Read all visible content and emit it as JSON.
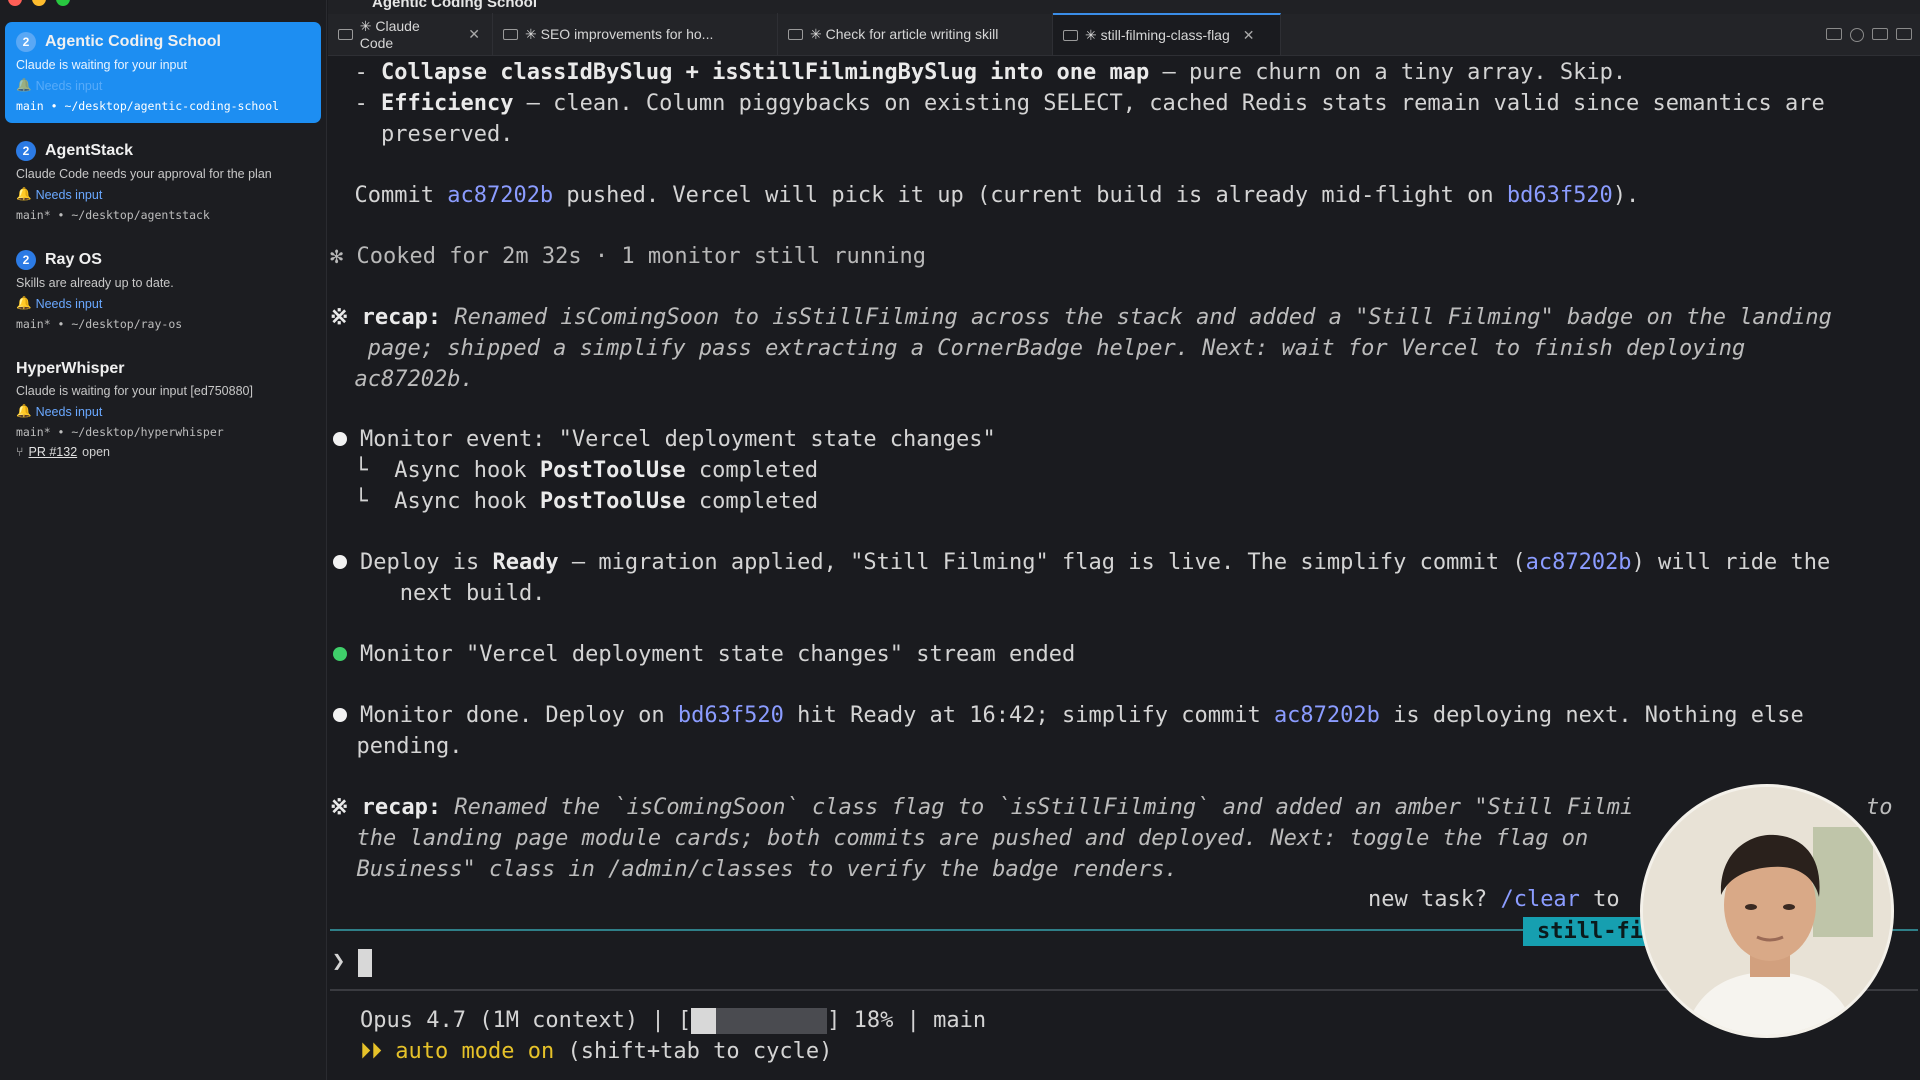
{
  "window": {
    "title": "Agentic Coding School"
  },
  "sessions": [
    {
      "num": "2",
      "title": "Agentic Coding School",
      "desc": "Claude is waiting for your input",
      "needs": "Needs input",
      "branch": "main • ~/desktop/agentic-coding-school"
    },
    {
      "num": "2",
      "title": "AgentStack",
      "desc": "Claude Code needs your approval for the plan",
      "needs": "Needs input",
      "branch": "main* • ~/desktop/agentstack"
    },
    {
      "num": "2",
      "title": "Ray OS",
      "desc": "Skills are already up to date.",
      "needs": "Needs input",
      "branch": "main* • ~/desktop/ray-os"
    },
    {
      "title": "HyperWhisper",
      "desc": "Claude is waiting for your input [ed750880]",
      "needs": "Needs input",
      "branch": "main* • ~/desktop/hyperwhisper",
      "pr_link": "PR #132",
      "pr_state": "open"
    }
  ],
  "tabs": [
    {
      "label": "✳ Claude Code"
    },
    {
      "label": "✳ SEO improvements for ho..."
    },
    {
      "label": "✳ Check for article writing skill"
    },
    {
      "label": "✳ still-filming-class-flag"
    }
  ],
  "terminal": {
    "l1": {
      "prefix": "  - ",
      "b1": "Collapse ",
      "h1": "classIdBySlug",
      "b2": " + ",
      "h2": "isStillFilmingBySlug",
      "b3": " into one map",
      "rest": " — pure churn on a tiny array. Skip."
    },
    "l2": {
      "prefix": "  - ",
      "b1": "Efficiency",
      "rest": " — clean. Column piggybacks on existing SELECT, cached Redis stats remain valid since semantics are"
    },
    "l3": "    preserved.",
    "commit": {
      "a": "  Commit ",
      "h1": "ac87202b",
      "b": " pushed. Vercel will pick it up (current build is already mid-flight on ",
      "h2": "bd63f520",
      "c": ")."
    },
    "cooked": "✻ Cooked for 2m 32s · 1 monitor still running",
    "recap1": {
      "label": "※ recap:",
      "l1": " Renamed isComingSoon to isStillFilming across the stack and added a \"Still Filming\" badge on the landing",
      "l2": "   page; shipped a simplify pass extracting a CornerBadge helper. Next: wait for Vercel to finish deploying",
      "l3": "  ac87202b."
    },
    "monitor_event": "Monitor event: \"Vercel deployment state changes\"",
    "hook1": {
      "a": "  └  Async hook ",
      "b": "PostToolUse",
      "c": " completed"
    },
    "hook2": {
      "a": "  └  Async hook ",
      "b": "PostToolUse",
      "c": " completed"
    },
    "deploy": {
      "a": "Deploy is ",
      "b": "Ready",
      "c": " — migration applied, \"Still Filming\" flag is live. The simplify commit (",
      "h": "ac87202b",
      "d": ") will ride the"
    },
    "deploy2": "   next build.",
    "stream": "Monitor \"Vercel deployment state changes\" stream ended",
    "done": {
      "a": "Monitor done. Deploy on ",
      "h1": "bd63f520",
      "b": " hit Ready at 16:42; simplify commit ",
      "h2": "ac87202b",
      "c": " is deploying next. Nothing else"
    },
    "done2": "  pending.",
    "recap2": {
      "label": "※ recap:",
      "l1": " Renamed the `isComingSoon` class flag to `isStillFilming` and added an amber \"Still Filmi",
      "l1b": "to",
      "l2": "  the landing page module cards; both commits are pushed and deployed. Next: toggle the flag on",
      "l3": "  Business\" class in /admin/classes to verify the badge renders."
    },
    "newtask": {
      "a": "new task? ",
      "h": "/clear",
      "b": " to"
    },
    "badge": "still-fi",
    "prompt": "❯",
    "status": {
      "model": "Opus 4.7 (1M context) | [",
      "end": "] 18% | main",
      "progress": 0.18
    },
    "auto": {
      "arrows": "⏵⏵",
      "a": " auto mode on",
      "b": " (shift+tab to cycle)"
    }
  }
}
